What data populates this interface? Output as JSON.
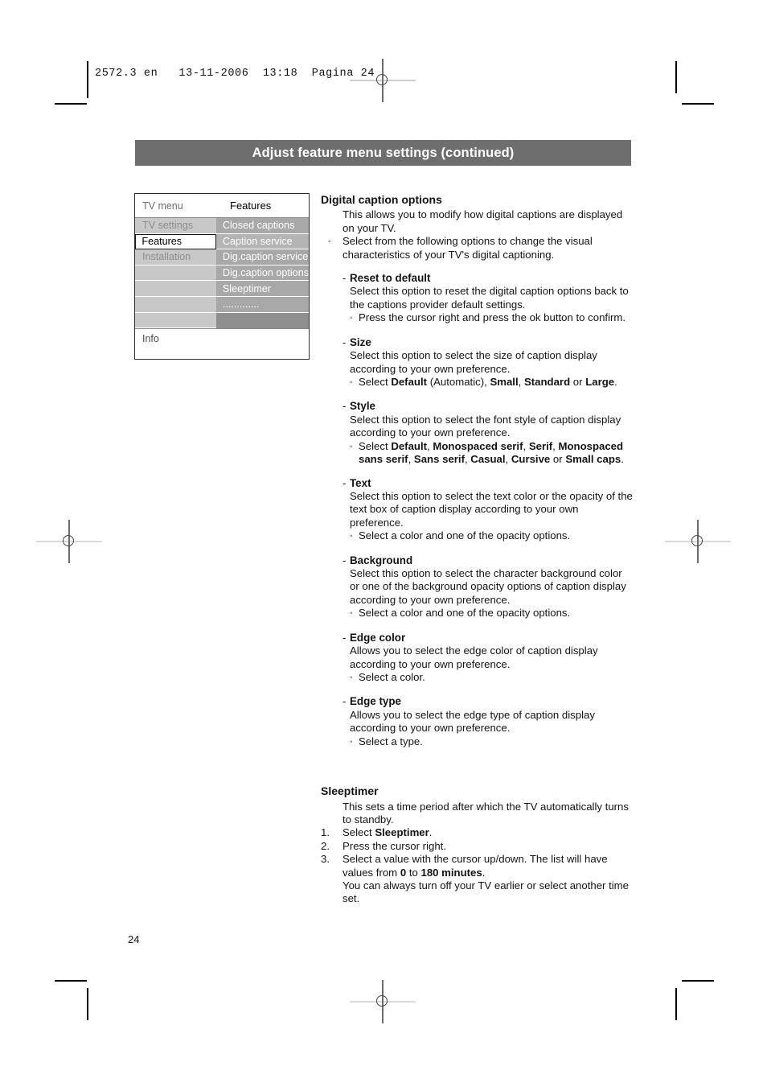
{
  "print_marks": {
    "slug_line": "2572.3 en   13-11-2006  13:18  Pagina 24"
  },
  "header": {
    "title": "Adjust feature menu settings (continued)"
  },
  "tv_menu": {
    "header_left": "TV menu",
    "header_right": "Features",
    "left_items": [
      {
        "label": "TV settings",
        "selected": false
      },
      {
        "label": "Features",
        "selected": true
      },
      {
        "label": "Installation",
        "selected": false
      },
      {
        "label": "",
        "selected": false
      },
      {
        "label": "",
        "selected": false
      },
      {
        "label": "",
        "selected": false
      },
      {
        "label": "",
        "selected": false
      }
    ],
    "right_items": [
      {
        "label": "Closed captions",
        "style": "normal"
      },
      {
        "label": "Caption service",
        "style": "lighter"
      },
      {
        "label": "Dig.caption service",
        "style": "normal"
      },
      {
        "label": "Dig.caption options",
        "style": "normal"
      },
      {
        "label": "Sleeptimer",
        "style": "normal"
      },
      {
        "label": ".............",
        "style": "normal"
      },
      {
        "label": "",
        "style": "blank"
      }
    ],
    "info_label": "Info"
  },
  "main": {
    "section1": {
      "title": "Digital caption options",
      "intro": "This allows you to modify how digital captions are displayed on your TV.",
      "bullet1": "Select from the following options to change the visual characteristics of your TV's digital captioning.",
      "options": [
        {
          "name": "Reset to default",
          "body": "Select this option to reset the digital caption options back to the captions provider default settings.",
          "sub": "Press the cursor right and press the ok button to confirm."
        },
        {
          "name": "Size",
          "body": "Select this option to select the size of caption display according to your own preference.",
          "sub_prefix": "Select ",
          "sub_rich": "Select Default (Automatic), Small, Standard or Large."
        },
        {
          "name": "Style",
          "body": "Select this option to select the font style of caption display according to your own preference.",
          "sub_rich": "Select Default, Monospaced serif, Serif, Monospaced sans serif, Sans serif, Casual, Cursive or Small caps."
        },
        {
          "name": "Text",
          "body": "Select this option to select the text color or the opacity of the text box of caption display according to your own preference.",
          "sub": "Select a color and one of the opacity options."
        },
        {
          "name": "Background",
          "body": "Select this option to select the character background color or one of the background opacity options of caption display according to your own preference.",
          "sub": "Select a color and one of the opacity options."
        },
        {
          "name": "Edge color",
          "body": "Allows you to select the edge color of caption display according to your own preference.",
          "sub": "Select a color."
        },
        {
          "name": "Edge type",
          "body": "Allows you to select the edge type of caption display according to your own preference.",
          "sub": "Select a type."
        }
      ]
    },
    "section2": {
      "title": "Sleeptimer",
      "intro": "This sets a time period after which the TV automatically turns to standby.",
      "steps": [
        {
          "num": "1.",
          "text_plain": "Select Sleeptimer."
        },
        {
          "num": "2.",
          "text_plain": "Press the cursor right."
        },
        {
          "num": "3.",
          "text_plain": "Select a value with the cursor up/down. The list will have values from 0 to 180 minutes."
        }
      ],
      "closing": "You can always turn off your TV earlier or select another time set."
    }
  },
  "footer": {
    "page_number": "24"
  },
  "icons": {
    "bullet": "◦",
    "dash": "-"
  },
  "colors": {
    "title_bar_bg": "#6e6e6e",
    "title_bar_text": "#ffffff",
    "menu_left_row": "#c8c8c8",
    "menu_right_row": "#a8a8a8",
    "menu_right_row_alt": "#b4b4b4",
    "menu_blank_row": "#8f8f8f",
    "text": "#141414"
  }
}
